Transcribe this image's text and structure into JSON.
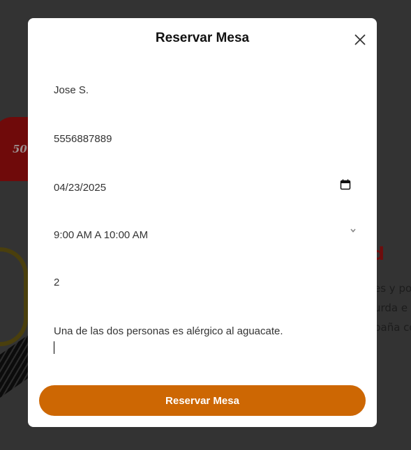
{
  "background": {
    "badge_text": "50",
    "heading_fragment": "ad",
    "paragraph_fragments": [
      "es y po",
      "urda e",
      "paña co"
    ]
  },
  "modal": {
    "title": "Reservar Mesa",
    "close_icon": "close-icon",
    "fields": {
      "name": "Jose S.",
      "phone": "5556887889",
      "date": "04/23/2025",
      "time": "9:00 AM A 10:00 AM",
      "guests": "2",
      "notes": "Una de las dos personas es alérgico al aguacate."
    },
    "submit_label": "Reservar Mesa"
  },
  "colors": {
    "overlay": "#333333",
    "accent": "#cd6703",
    "modal_bg": "#ffffff"
  }
}
